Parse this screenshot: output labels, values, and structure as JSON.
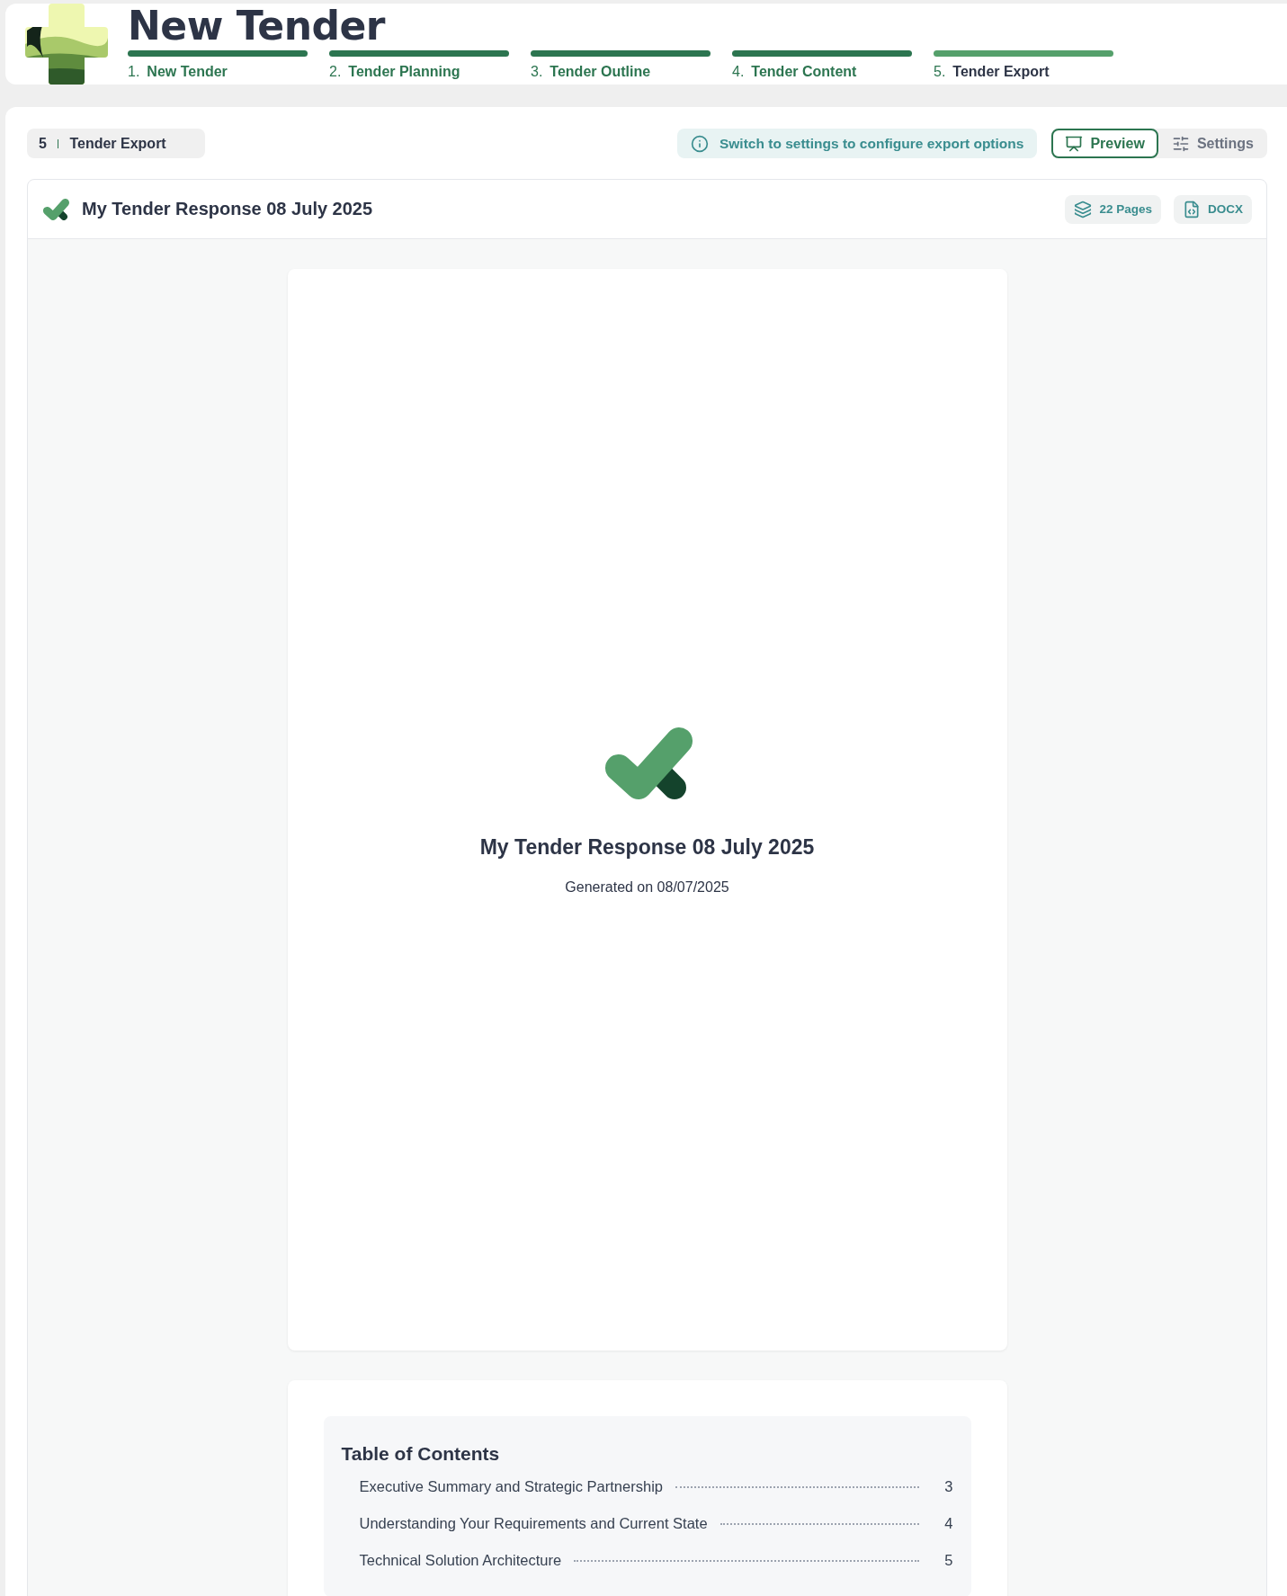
{
  "header": {
    "title": "New Tender",
    "steps": [
      {
        "number": "1.",
        "label": "New Tender",
        "selected": false
      },
      {
        "number": "2.",
        "label": "Tender Planning",
        "selected": false
      },
      {
        "number": "3.",
        "label": "Tender Outline",
        "selected": false
      },
      {
        "number": "4.",
        "label": "Tender Content",
        "selected": false
      },
      {
        "number": "5.",
        "label": "Tender Export",
        "selected": true
      }
    ]
  },
  "toolbar": {
    "step_number": "5",
    "step_label": "Tender Export",
    "info": "Switch to settings to configure export options",
    "modes": [
      {
        "kind": "preview",
        "label": "Preview",
        "selected": true
      },
      {
        "kind": "settings",
        "label": "Settings",
        "selected": false
      }
    ]
  },
  "document": {
    "title": "My Tender Response 08 July 2025",
    "badges": [
      {
        "kind": "pages",
        "label": "22 Pages"
      },
      {
        "kind": "format",
        "label": "DOCX"
      }
    ],
    "cover": {
      "title": "My Tender Response 08 July 2025",
      "subtitle": "Generated on 08/07/2025"
    },
    "toc": {
      "heading": "Table of Contents",
      "entries": [
        {
          "title": "Executive Summary and Strategic Partnership",
          "page": "3"
        },
        {
          "title": "Understanding Your Requirements and Current State",
          "page": "4"
        },
        {
          "title": "Technical Solution Architecture",
          "page": "5"
        }
      ]
    }
  }
}
